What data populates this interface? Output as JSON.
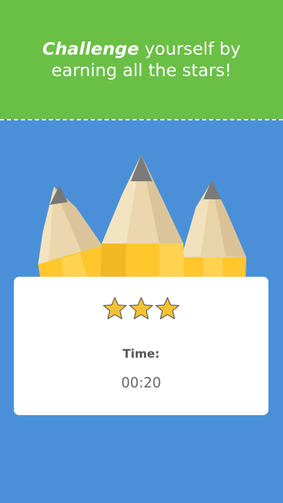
{
  "header": {
    "title_emphasis": "Challenge",
    "title_rest": " yourself by earning all the stars!"
  },
  "result_card": {
    "stars_earned": 3,
    "stars_total": 3,
    "time_label": "Time:",
    "time_value": "00:20"
  },
  "colors": {
    "header_green": "#6abf45",
    "background_blue": "#4a90d9",
    "star_gold": "#f6c231",
    "pencil_wood": "#e8d5a8",
    "pencil_body": "#ffc72c"
  },
  "icons": [
    "pencil-illustration",
    "star-icon"
  ]
}
